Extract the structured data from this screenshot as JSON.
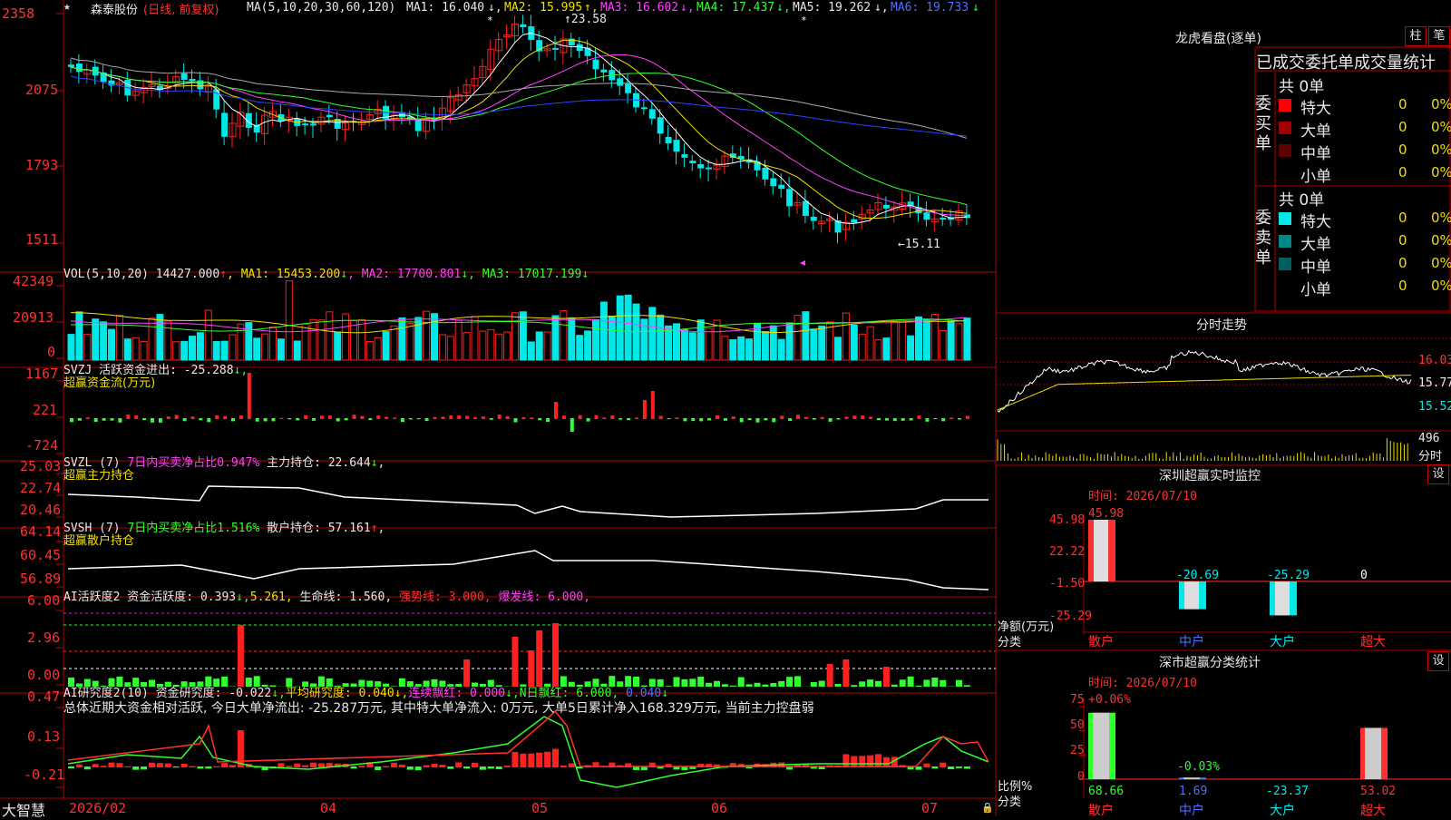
{
  "title": {
    "star": "★",
    "stock": "森泰股份",
    "period": "(日线, 前复权)",
    "ma_def": "MA(5,10,20,30,60,120)",
    "ma1": "MA1: 16.040",
    "ma2": "MA2: 15.995",
    "ma3": "MA3: 16.602",
    "ma4": "MA4: 17.437",
    "ma5": "MA5: 19.262",
    "ma6": "MA6: 19.733"
  },
  "price_axis": [
    "2358",
    "2075",
    "1793",
    "1511"
  ],
  "price_marks": {
    "high": "23.58",
    "low": "15.11"
  },
  "vol": {
    "def": "VOL(5,10,20)",
    "val": "14427.000",
    "ma1": "MA1: 15453.200",
    "ma2": "MA2: 17700.801",
    "ma3": "MA3: 17017.199",
    "axis": [
      "42349",
      "20913",
      "0"
    ]
  },
  "svzj": {
    "line1": "SVZJ  活跃资金进出: -25.288",
    "line2": "超赢资金流(万元)",
    "axis": [
      "1167",
      "221",
      "-724"
    ]
  },
  "svzl": {
    "p1": "SVZL (7) ",
    "p2": "7日内买卖净占比0.947%",
    "p3": "主力持仓: 22.644",
    "line2": "超赢主力持仓",
    "axis": [
      "25.03",
      "22.74",
      "20.46"
    ]
  },
  "svsh": {
    "p1": "SVSH (7) ",
    "p2": "7日内买卖净占比1.516%",
    "p3": "散户持仓: 57.161",
    "line2": "超赢散户持仓",
    "axis": [
      "64.14",
      "60.45",
      "56.89"
    ]
  },
  "ai1": {
    "p1": "AI活跃度2 资金活跃度: 0.393",
    "p2": "5.261",
    "p3": "生命线: 1.560",
    "p4": "强势线: 3.000",
    "p5": "爆发线: 6.000",
    "axis": [
      "6.00",
      "2.96",
      "0.00"
    ]
  },
  "ai2": {
    "p1": "AI研究度2(10) 资金研究度: -0.022",
    "p2": "平均研究度: 0.040",
    "p3": "连续飘红: 0.000",
    "p4": "N日飘红: 6.000",
    "p5": "0.040",
    "summary": "总体近期大资金相对活跃, 今日大单净流出: -25.287万元, 其中特大单净流入: 0万元, 大单5日累计净入168.329万元, 当前主力控盘弱",
    "axis": [
      "0.47",
      "0.13",
      "-0.21"
    ]
  },
  "date_axis": {
    "brand": "大智慧",
    "labels": [
      "2026/02",
      "04",
      "05",
      "06",
      "07"
    ]
  },
  "dragon": {
    "title": "龙虎看盘(逐单)",
    "btn1": "柱",
    "btn2": "笔",
    "subtitle": "已成交委托单成交量统计",
    "buy": {
      "label": "委买单",
      "total": "共 0单",
      "rows": [
        {
          "name": "特大",
          "v": "0",
          "p": "0%",
          "color": "#ff0000"
        },
        {
          "name": "大单",
          "v": "0",
          "p": "0%",
          "color": "#a00000"
        },
        {
          "name": "中单",
          "v": "0",
          "p": "0%",
          "color": "#600000"
        },
        {
          "name": "小单",
          "v": "0",
          "p": "0%",
          "color": "#000000"
        }
      ]
    },
    "sell": {
      "label": "委卖单",
      "total": "共 0单",
      "rows": [
        {
          "name": "特大",
          "v": "0",
          "p": "0%",
          "color": "#00e8e8"
        },
        {
          "name": "大单",
          "v": "0",
          "p": "0%",
          "color": "#008888"
        },
        {
          "name": "中单",
          "v": "0",
          "p": "0%",
          "color": "#006060"
        },
        {
          "name": "小单",
          "v": "0",
          "p": "0%",
          "color": "#000000"
        }
      ]
    }
  },
  "intraday": {
    "title": "分时走势",
    "axis": [
      "16.03",
      "15.77",
      "15.52"
    ],
    "vol": "496",
    "vol_unit": "分时"
  },
  "sz_monitor": {
    "title": "深圳超赢实时监控",
    "btn": "设",
    "time": "时间: 2026/07/10",
    "axis": [
      "45.98",
      "22.22",
      "-1.50",
      "-25.29"
    ],
    "unit": "净额(万元)",
    "cat_label": "分类",
    "categories": [
      "散户",
      "中户",
      "大户",
      "超大"
    ],
    "values": [
      45.98,
      -20.69,
      -25.29,
      0
    ],
    "value_labels": [
      "45.98",
      "-20.69",
      "-25.29",
      "0"
    ]
  },
  "sz_stats": {
    "title": "深市超赢分类统计",
    "btn": "设",
    "time": "时间: 2026/07/10",
    "axis": [
      "75",
      "50",
      "25",
      "0"
    ],
    "tops": [
      "+0.06%",
      "-0.03%"
    ],
    "unit": "比例%",
    "cat_label": "分类",
    "categories": [
      "散户",
      "中户",
      "大户",
      "超大"
    ],
    "values": [
      68.66,
      1.69,
      -23.37,
      53.02
    ],
    "value_labels": [
      "68.66",
      "1.69",
      "-23.37",
      "53.02"
    ],
    "colors": [
      "#30ff30",
      "#5070ff",
      "#00e8e8",
      "#ff3030"
    ]
  }
}
